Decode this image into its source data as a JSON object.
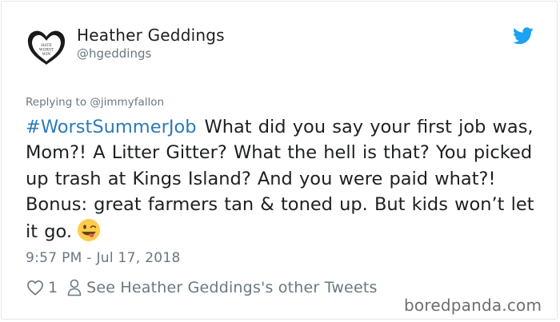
{
  "author": {
    "name": "Heather Geddings",
    "handle": "@hgeddings",
    "avatar_text": "HATE WORST WIN"
  },
  "reply_to": "Replying to @jimmyfallon",
  "tweet": {
    "hashtag": "#WorstSummerJob",
    "text": "What did you say your first job was, Mom?! A Litter Gitter? What the hell is that? You picked up trash at Kings Island? And you were paid what?! Bonus: great farmers tan & toned up. But kids won’t let it go.",
    "emoji": "winking-face-with-tongue"
  },
  "timestamp": "9:57 PM - Jul 17, 2018",
  "actions": {
    "likes": "1",
    "profile_link": "See Heather Geddings's other Tweets"
  },
  "watermark": "boredpanda.com",
  "colors": {
    "link": "#2b7bb9",
    "muted": "#697882",
    "twitter_blue": "#1da1f2"
  }
}
